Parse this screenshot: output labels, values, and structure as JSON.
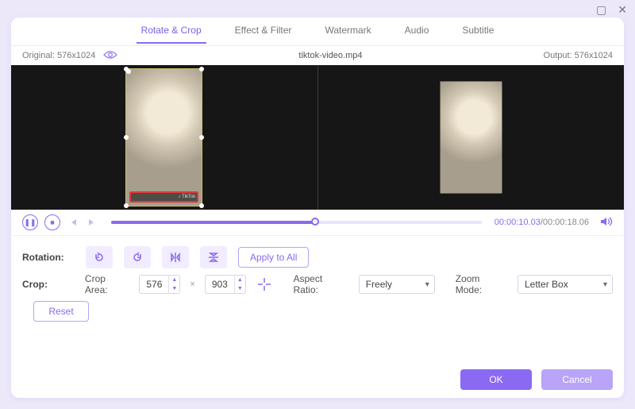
{
  "window": {
    "minimize_glyph": "▢",
    "close_glyph": "✕"
  },
  "tabs": {
    "rotate_crop": "Rotate & Crop",
    "effect_filter": "Effect & Filter",
    "watermark": "Watermark",
    "audio": "Audio",
    "subtitle": "Subtitle"
  },
  "header": {
    "original_label": "Original: 576x1024",
    "filename": "tiktok-video.mp4",
    "output_label": "Output: 576x1024"
  },
  "preview": {
    "watermark_text": "♪ TikTok"
  },
  "playback": {
    "current_time": "00:00:10.03",
    "total_time": "/00:00:18.06"
  },
  "rotation": {
    "label": "Rotation:",
    "apply_all": "Apply to All"
  },
  "crop": {
    "label": "Crop:",
    "area_label": "Crop Area:",
    "width": "576",
    "height": "903",
    "aspect_label": "Aspect Ratio:",
    "aspect_value": "Freely",
    "zoom_label": "Zoom Mode:",
    "zoom_value": "Letter Box"
  },
  "buttons": {
    "reset": "Reset",
    "ok": "OK",
    "cancel": "Cancel"
  },
  "icons": {
    "eye": "◉",
    "pause": "❚❚",
    "stop": "■",
    "prev": "⏮",
    "next": "⏭",
    "volume": "🔊",
    "times": "×"
  }
}
